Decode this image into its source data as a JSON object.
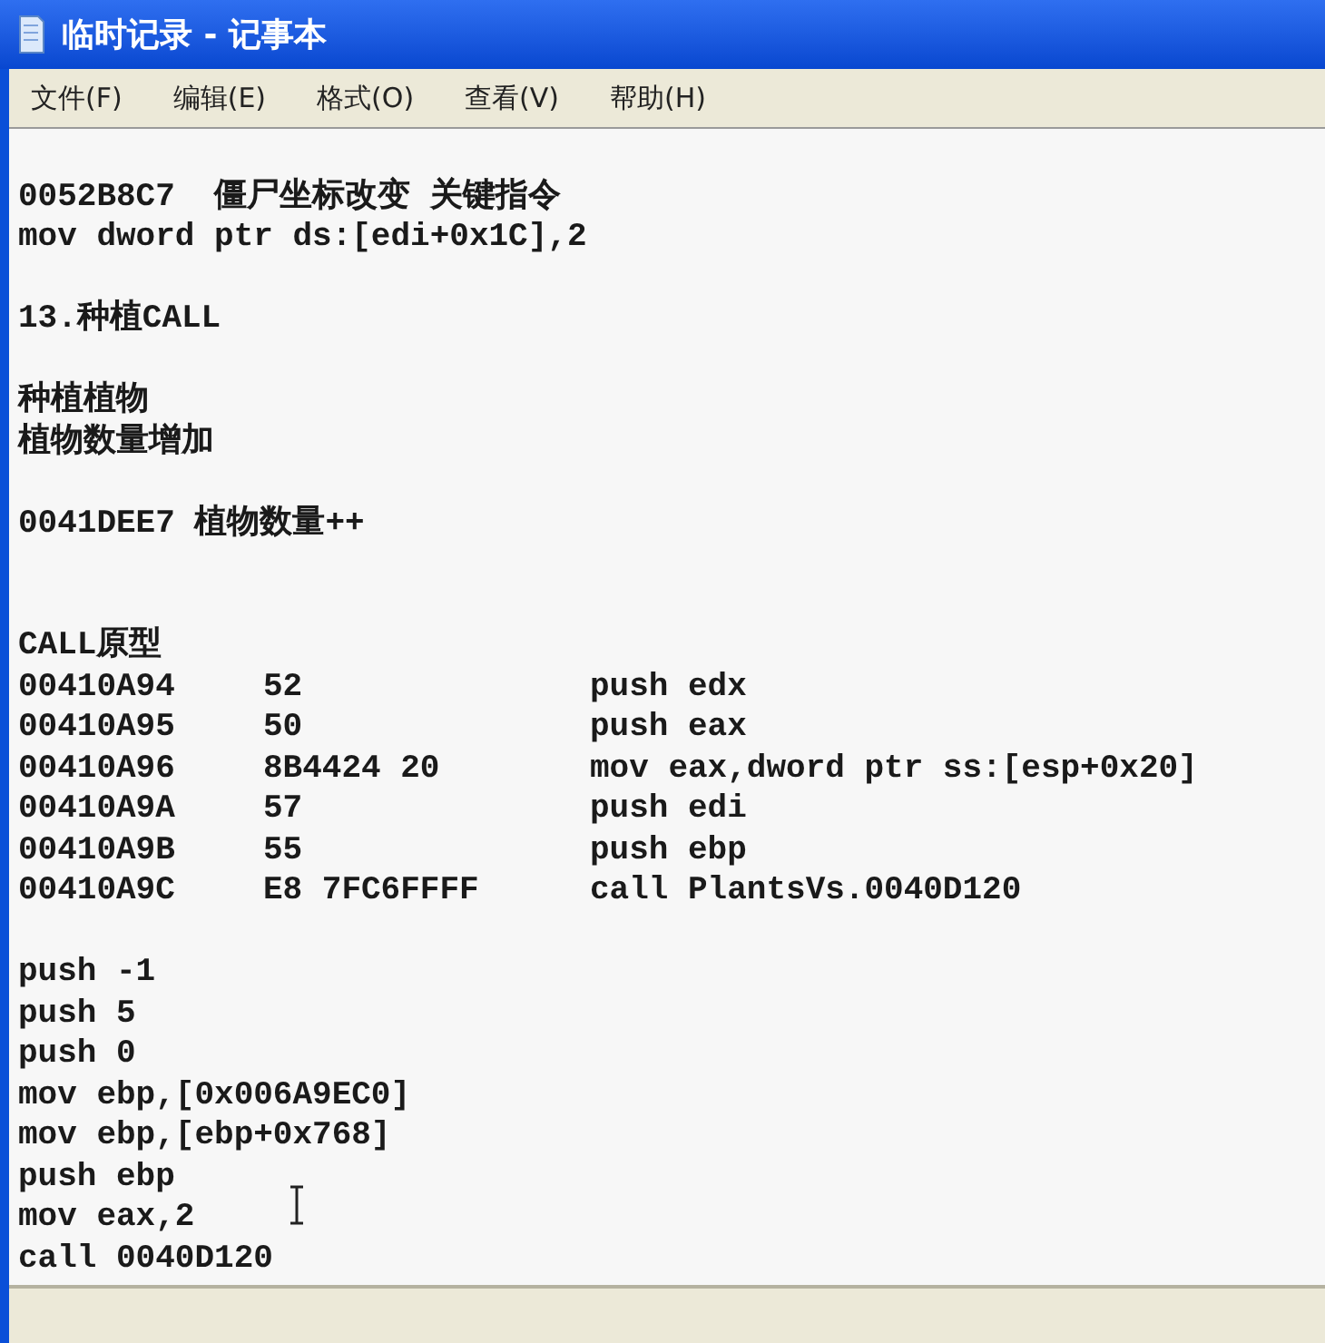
{
  "window": {
    "title": "临时记录 - 记事本"
  },
  "menu": [
    "文件(F)",
    "编辑(E)",
    "格式(O)",
    "查看(V)",
    "帮助(H)"
  ],
  "lines": [
    {
      "kind": "blank"
    },
    {
      "kind": "text",
      "text": "0052B8C7  僵尸坐标改变 关键指令"
    },
    {
      "kind": "text",
      "text": "mov dword ptr ds:[edi+0x1C],2"
    },
    {
      "kind": "blank"
    },
    {
      "kind": "text",
      "text": "13.种植CALL"
    },
    {
      "kind": "blank"
    },
    {
      "kind": "text",
      "text": "种植植物"
    },
    {
      "kind": "text",
      "text": "植物数量增加"
    },
    {
      "kind": "blank"
    },
    {
      "kind": "text",
      "text": "0041DEE7 植物数量++"
    },
    {
      "kind": "blank"
    },
    {
      "kind": "blank"
    },
    {
      "kind": "text",
      "text": "CALL原型"
    },
    {
      "kind": "row",
      "cells": [
        "00410A94",
        "52",
        "push edx"
      ]
    },
    {
      "kind": "row",
      "cells": [
        "00410A95",
        "50",
        "push eax"
      ]
    },
    {
      "kind": "row",
      "cells": [
        "00410A96",
        "8B4424 20",
        "mov eax,dword ptr ss:[esp+0x20]"
      ]
    },
    {
      "kind": "row",
      "cells": [
        "00410A9A",
        "57",
        "push edi"
      ]
    },
    {
      "kind": "row",
      "cells": [
        "00410A9B",
        "55",
        "push ebp"
      ]
    },
    {
      "kind": "row",
      "cells": [
        "00410A9C",
        "E8 7FC6FFFF",
        "call PlantsVs.0040D120"
      ]
    },
    {
      "kind": "blank"
    },
    {
      "kind": "text",
      "text": "push -1"
    },
    {
      "kind": "text",
      "text": "push 5"
    },
    {
      "kind": "text",
      "text": "push 0"
    },
    {
      "kind": "text",
      "text": "mov ebp,[0x006A9EC0]"
    },
    {
      "kind": "text",
      "text": "mov ebp,[ebp+0x768]"
    },
    {
      "kind": "text",
      "text": "push ebp"
    },
    {
      "kind": "text",
      "text": "mov eax,2"
    },
    {
      "kind": "text",
      "text": "call 0040D120"
    }
  ]
}
